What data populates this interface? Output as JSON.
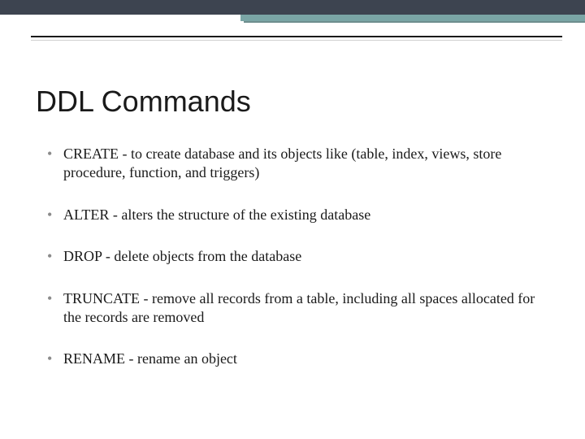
{
  "title": "DDL Commands",
  "bullets": [
    "CREATE - to create database and its objects like (table, index, views, store procedure, function, and triggers)",
    "ALTER - alters the structure of the existing database",
    "DROP - delete objects from the database",
    "TRUNCATE - remove all records from a table, including all spaces allocated for the records are removed",
    "RENAME - rename an object"
  ],
  "theme": {
    "dark_bar": "#3d4450",
    "teal_accent": "#7aa5a5",
    "rule_color": "#1a1a1a"
  }
}
